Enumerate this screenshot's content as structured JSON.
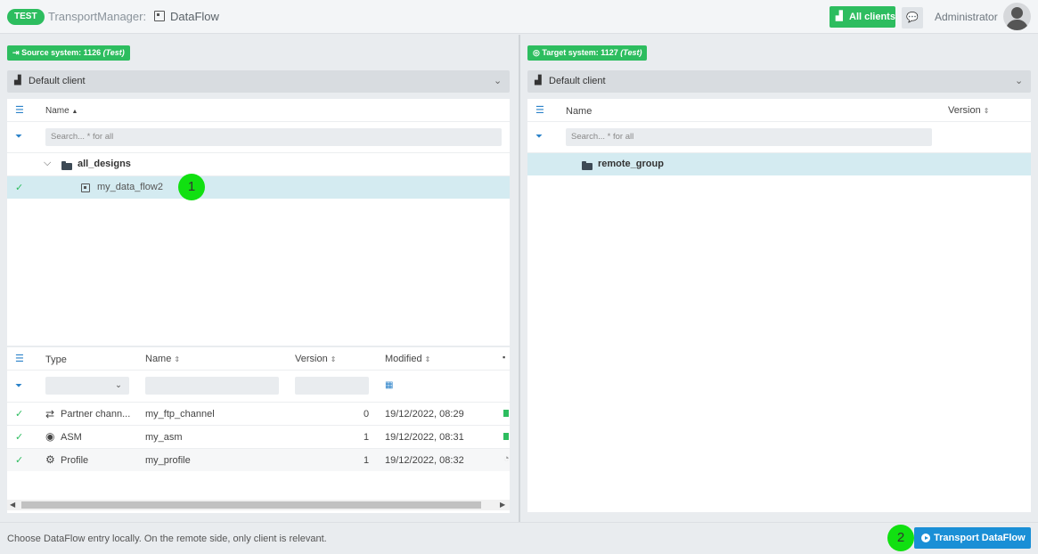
{
  "header": {
    "env_badge": "TEST",
    "app_title": "TransportManager:",
    "module_title": "DataFlow",
    "all_clients_label": "All clients",
    "user_name": "Administrator"
  },
  "source": {
    "badge_label": "Source system: 1126",
    "badge_suffix": "(Test)",
    "client_label": "Default client",
    "tree": {
      "col_name": "Name",
      "search_placeholder": "Search... * for all",
      "folder": "all_designs",
      "item": "my_data_flow2"
    },
    "details": {
      "columns": {
        "type": "Type",
        "name": "Name",
        "version": "Version",
        "modified": "Modified"
      },
      "rows": [
        {
          "type": "Partner chann...",
          "name": "my_ftp_channel",
          "version": "0",
          "modified": "19/12/2022, 08:29"
        },
        {
          "type": "ASM",
          "name": "my_asm",
          "version": "1",
          "modified": "19/12/2022, 08:31"
        },
        {
          "type": "Profile",
          "name": "my_profile",
          "version": "1",
          "modified": "19/12/2022, 08:32"
        }
      ]
    }
  },
  "target": {
    "badge_label": "Target system: 1127",
    "badge_suffix": "(Test)",
    "client_label": "Default client",
    "tree": {
      "col_name": "Name",
      "col_version": "Version",
      "search_placeholder": "Search... * for all",
      "folder": "remote_group"
    }
  },
  "callouts": {
    "one": "1",
    "two": "2"
  },
  "footer": {
    "status": "Choose DataFlow entry locally. On the remote side, only client is relevant.",
    "transport_label": "Transport DataFlow"
  },
  "colors": {
    "accent_green": "#2dbd5f",
    "accent_blue": "#1a8fd6",
    "selected_row": "#d4ebf1"
  }
}
